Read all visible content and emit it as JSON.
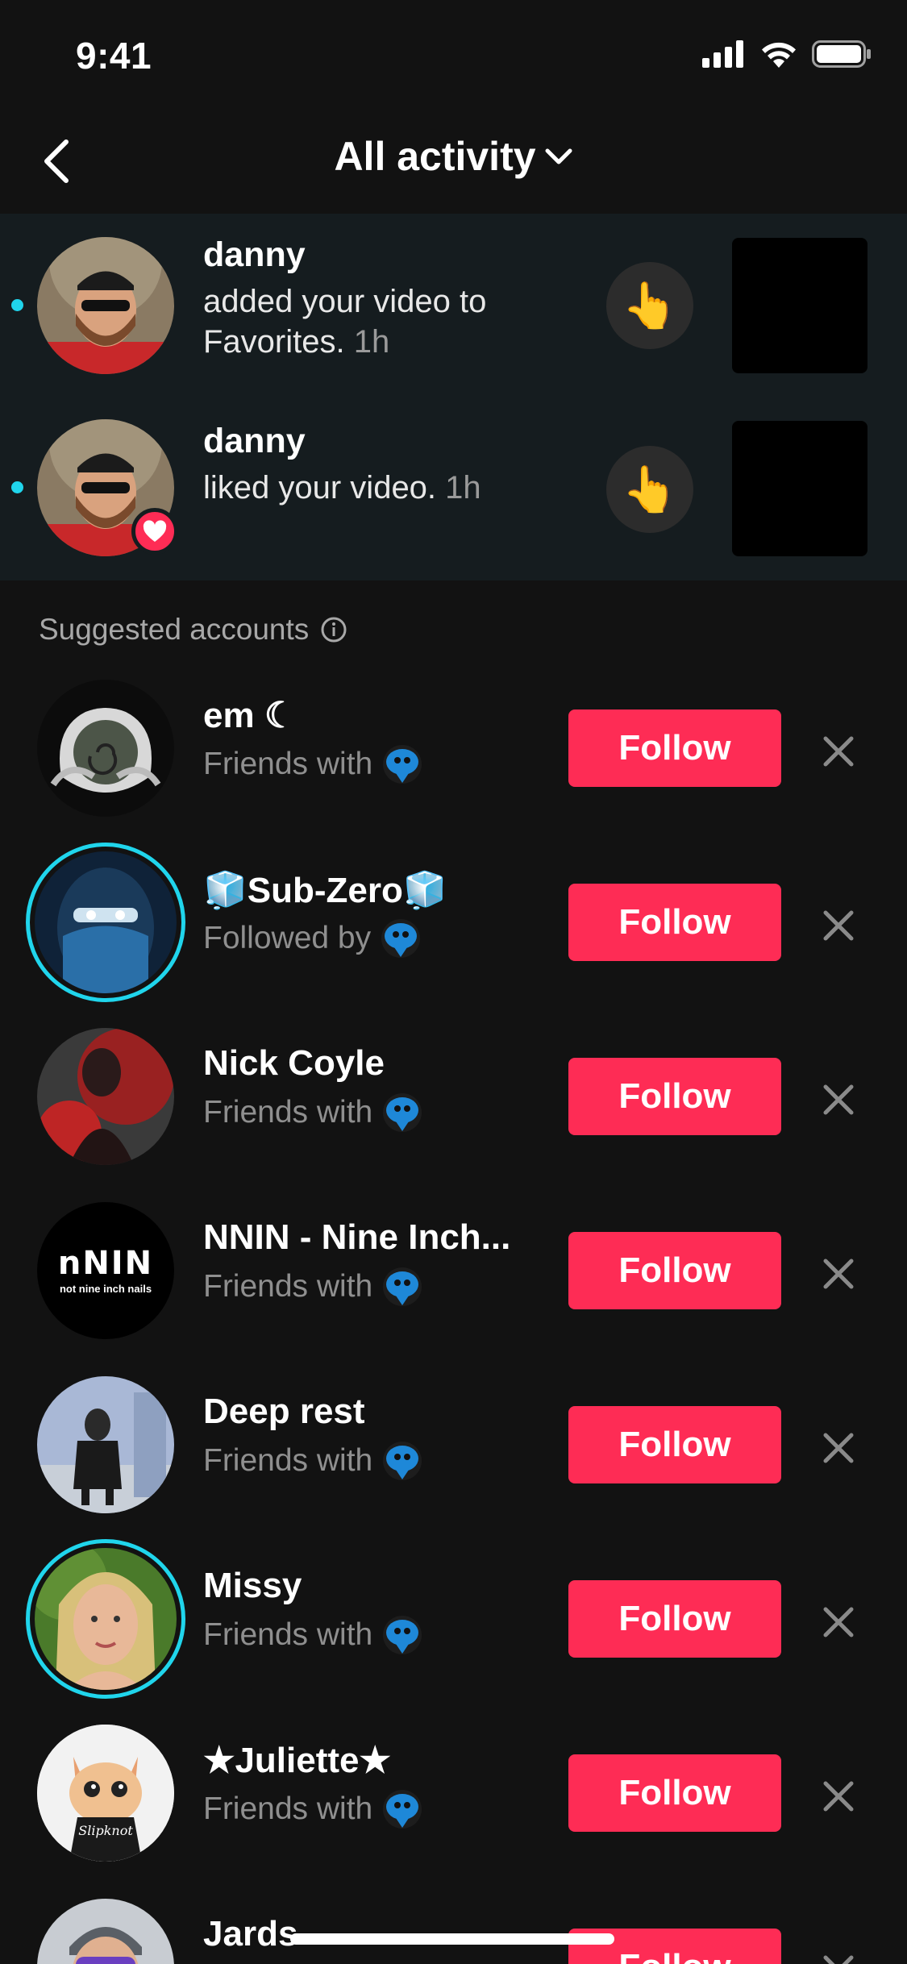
{
  "status_bar": {
    "time": "9:41"
  },
  "header": {
    "title": "All activity"
  },
  "notifications": [
    {
      "name": "danny",
      "message": "added your video to Favorites.",
      "time_ago": "1h",
      "unread": true
    },
    {
      "name": "danny",
      "message": "liked your video.",
      "time_ago": "1h",
      "unread": true,
      "badge": "heart"
    }
  ],
  "suggested": {
    "label": "Suggested accounts",
    "follow_label": "Follow",
    "accounts": [
      {
        "name": "em ☾",
        "relation": "Friends with",
        "ring": false
      },
      {
        "name": "🧊Sub-Zero🧊",
        "relation": "Followed by",
        "ring": true
      },
      {
        "name": "Nick Coyle",
        "relation": "Friends with",
        "ring": false
      },
      {
        "name": "NNIN - Nine Inch...",
        "relation": "Friends with",
        "ring": false,
        "avatar_text_1": "nNIN",
        "avatar_text_2": "not nine inch nails"
      },
      {
        "name": "Deep rest",
        "relation": "Friends with",
        "ring": false
      },
      {
        "name": "Missy",
        "relation": "Friends with",
        "ring": true
      },
      {
        "name": "★Juliette★",
        "relation": "Friends with",
        "ring": false,
        "avatar_text": "Slipknot"
      },
      {
        "name": "Jards",
        "relation": "",
        "ring": false
      }
    ]
  },
  "colors": {
    "accent": "#fe2c55",
    "unread_dot": "#20d5ec",
    "background": "#121212",
    "notif_bg": "#151c1f"
  }
}
